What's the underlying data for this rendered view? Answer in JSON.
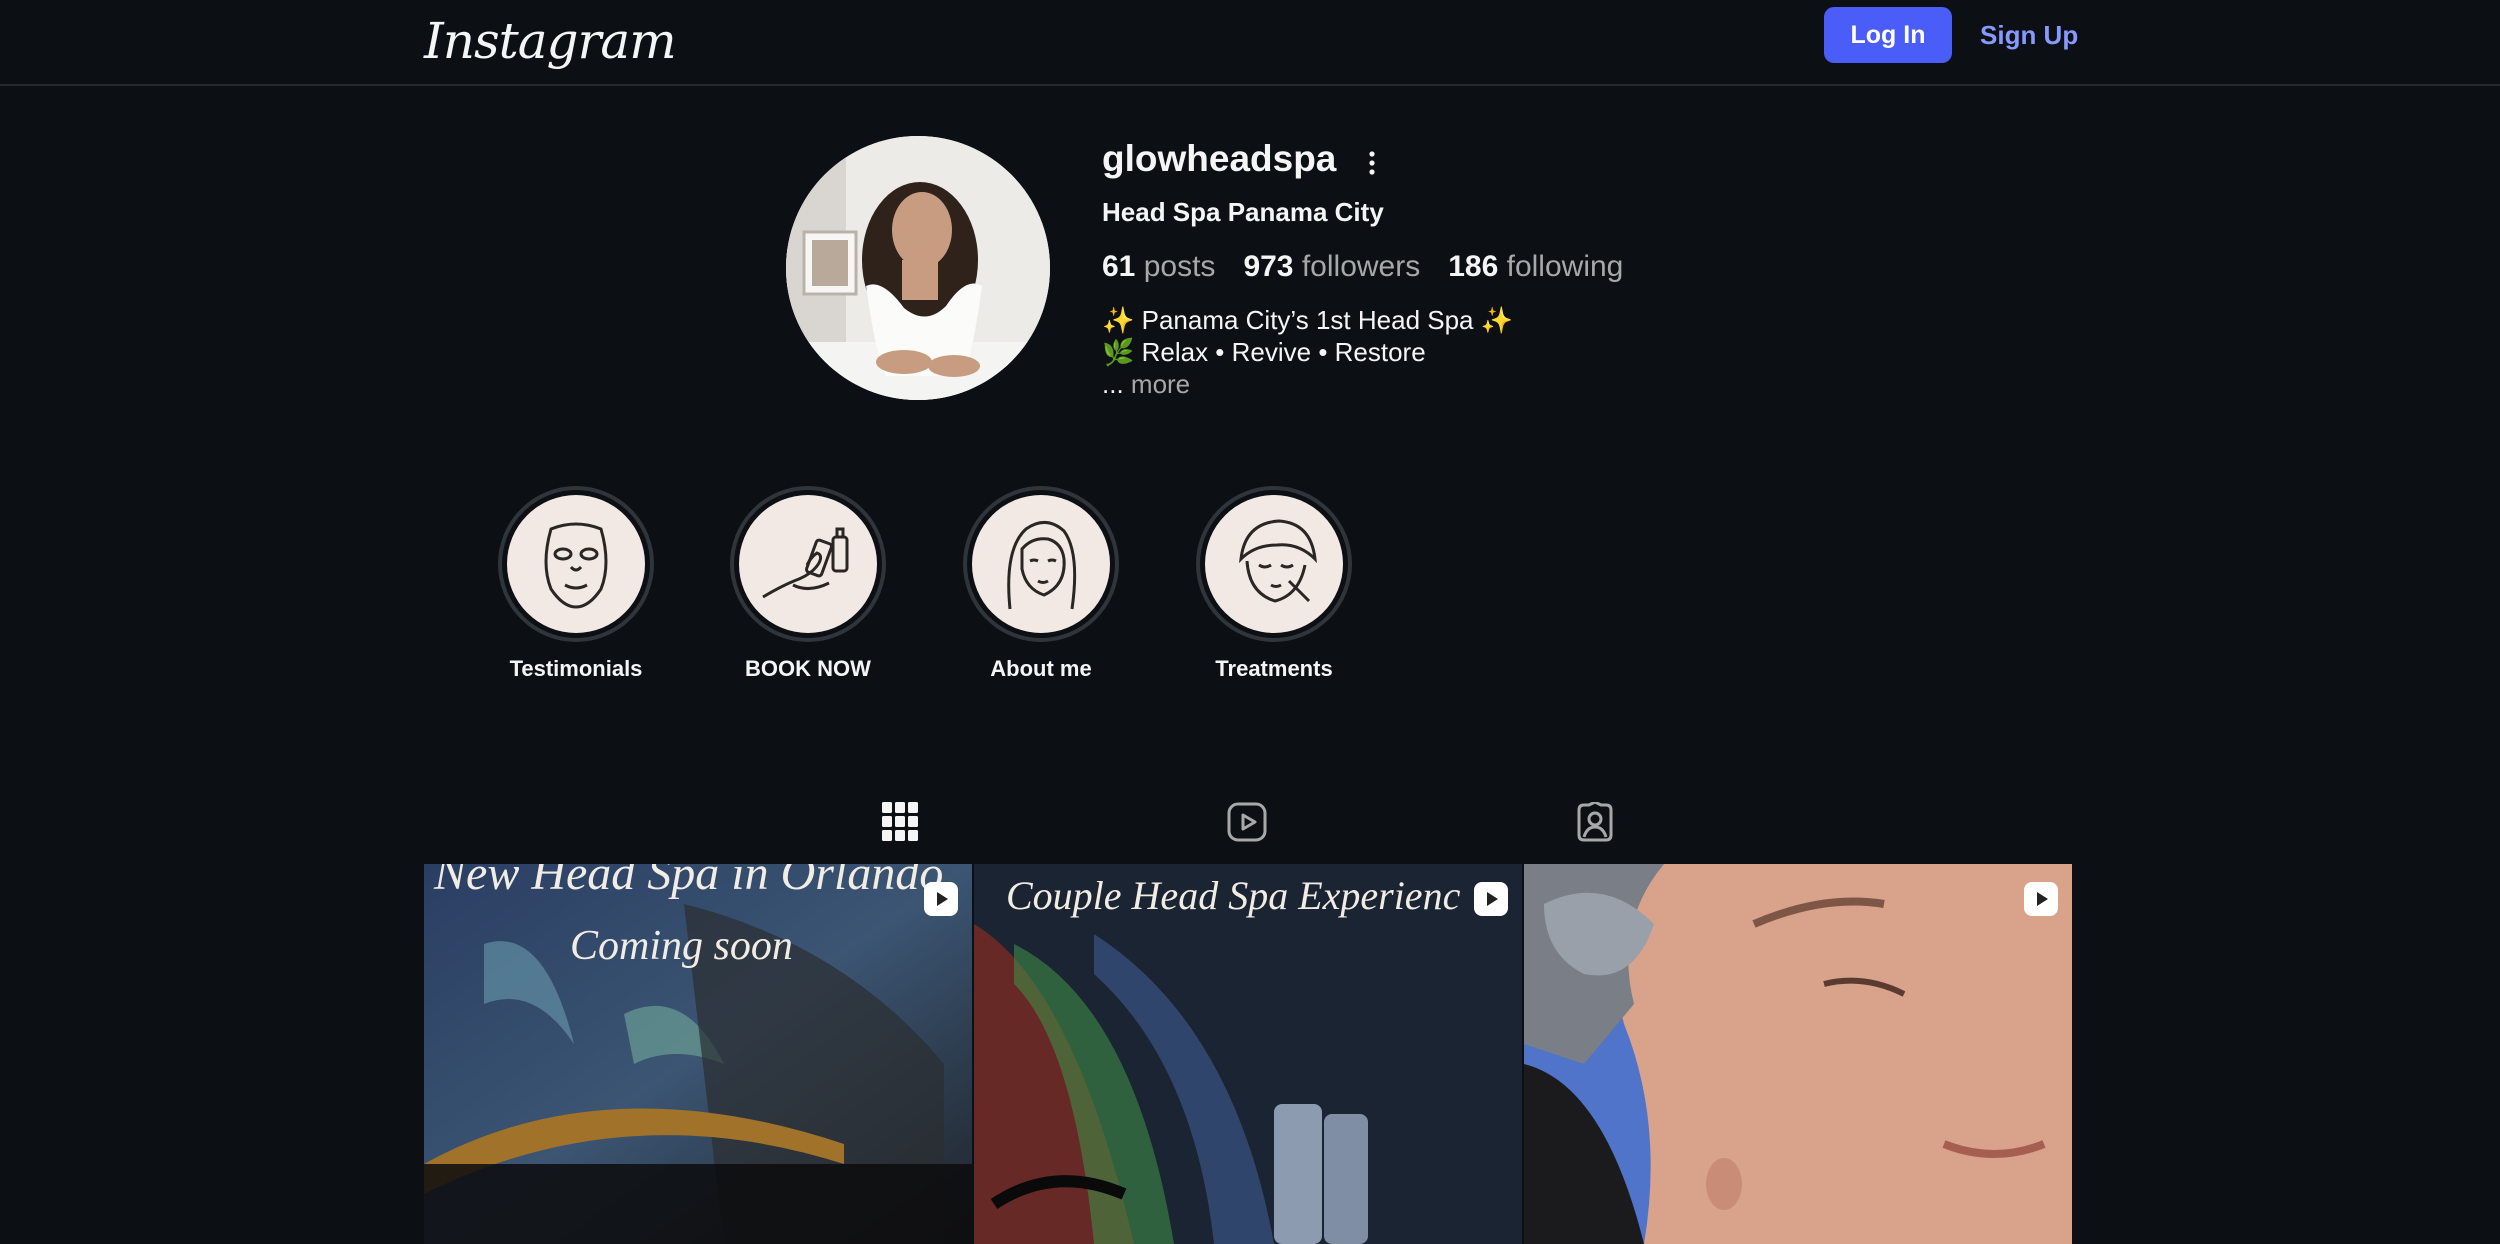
{
  "header": {
    "logo_text": "Instagram",
    "login_label": "Log In",
    "signup_label": "Sign Up"
  },
  "profile": {
    "username": "glowheadspa",
    "full_name": "Head Spa Panama City",
    "stats": {
      "posts": "61",
      "posts_label": "posts",
      "followers": "973",
      "followers_label": "followers",
      "following": "186",
      "following_label": "following"
    },
    "bio_line1": "✨ Panama City’s 1st Head Spa ✨",
    "bio_line2": "🌿 Relax • Revive • Restore",
    "bio_more_prefix": "...",
    "bio_more": "more"
  },
  "highlights": [
    {
      "label": "Testimonials",
      "icon": "face-mask-icon"
    },
    {
      "label": "BOOK NOW",
      "icon": "hand-bottle-icon"
    },
    {
      "label": "About me",
      "icon": "woman-face-icon"
    },
    {
      "label": "Treatments",
      "icon": "towel-face-icon"
    }
  ],
  "tabs": [
    {
      "name": "posts",
      "icon": "grid-icon"
    },
    {
      "name": "reels",
      "icon": "reels-icon"
    },
    {
      "name": "tagged",
      "icon": "tagged-icon"
    }
  ],
  "posts": [
    {
      "caption1": "New Head Spa in Orlando",
      "caption2": "Coming soon",
      "type": "reel"
    },
    {
      "caption1": "Couple Head Spa Experienc",
      "type": "reel"
    },
    {
      "caption1": "",
      "type": "reel"
    }
  ],
  "colors": {
    "background": "#0c1014",
    "primary_button": "#4a5df9",
    "link": "#8799ff",
    "muted_text": "#a8a8a8"
  }
}
